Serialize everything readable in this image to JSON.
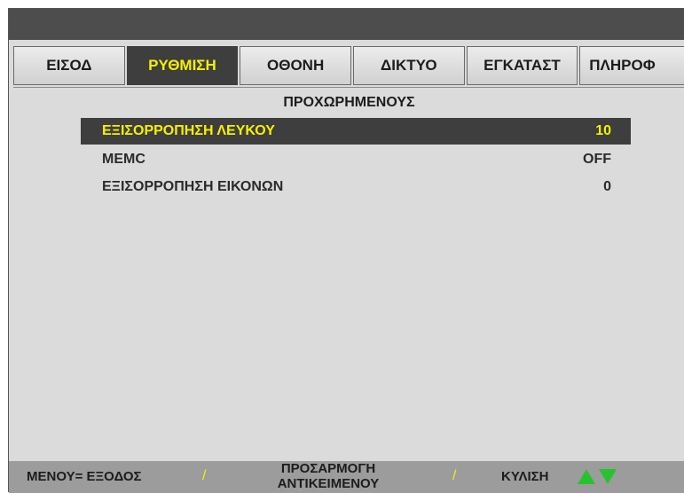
{
  "tabs": [
    {
      "label": "ΕΙΣΟΔ",
      "active": false
    },
    {
      "label": "ΡΥΘΜΙΣΗ",
      "active": true
    },
    {
      "label": "ΟΘΟΝΗ",
      "active": false
    },
    {
      "label": "ΔΙΚΤΥΟ",
      "active": false
    },
    {
      "label": "ΕΓΚΑΤΑΣΤ",
      "active": false
    },
    {
      "label": "ΠΛΗΡΟΦ",
      "active": false
    }
  ],
  "section": {
    "title": "ΠΡΟΧΩΡΗΜΕΝΟΥΣ"
  },
  "rows": [
    {
      "label": "ΕΞΙΣΟΡΡΟΠΗΣΗ ΛΕΥΚΟΥ",
      "value": "10",
      "selected": true
    },
    {
      "label": "MEMC",
      "value": "OFF",
      "selected": false
    },
    {
      "label": "ΕΞΙΣΟΡΡΟΠΗΣΗ ΕΙΚΟΝΩΝ",
      "value": "0",
      "selected": false
    }
  ],
  "footer": {
    "menu_exit": "ΜΕΝΟΥ= ΕΞΟΔΟΣ",
    "separator": "/",
    "adjust_line1": "ΠΡΟΣΑΡΜΟΓΗ",
    "adjust_line2": "ΑΝΤΙΚΕΙΜΕΝΟΥ",
    "scroll": "ΚΥΛΙΣΗ",
    "scroll_up_icon": "triangle-up",
    "scroll_down_icon": "triangle-down"
  },
  "colors": {
    "highlight_text": "#f5f000",
    "highlight_bg": "#3e3e3e",
    "arrow": "#25c42f"
  }
}
